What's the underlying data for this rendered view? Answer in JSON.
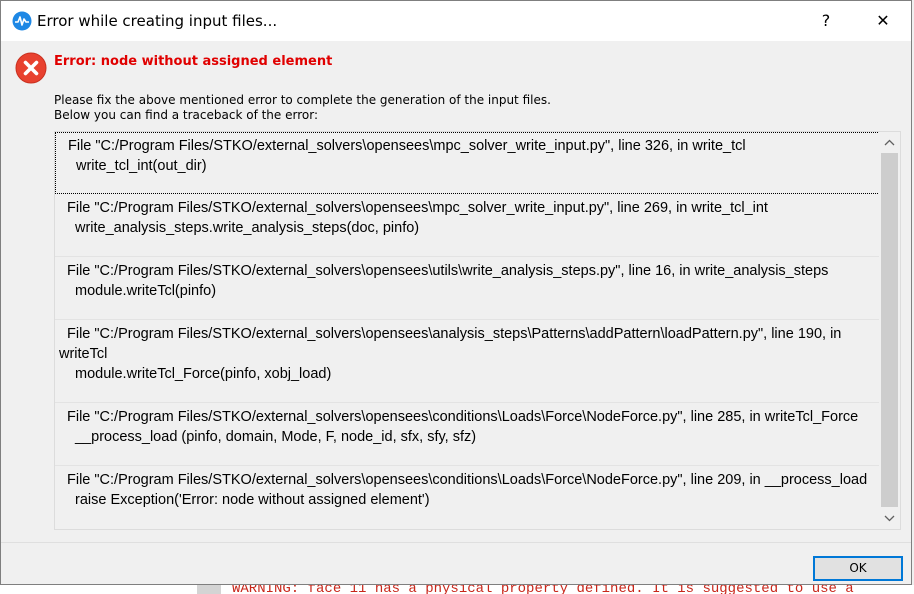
{
  "window": {
    "title": "Error while creating input files...",
    "help_label": "?",
    "close_label": "✕"
  },
  "error": {
    "title": "Error: node without assigned element",
    "message_line1": "Please fix the above mentioned error to complete the generation of the input files.",
    "message_line2": "Below you can find a traceback of the error:"
  },
  "traceback": [
    {
      "file_line": "File \"C:/Program Files/STKO/external_solvers\\opensees\\mpc_solver_write_input.py\", line 326, in write_tcl",
      "code": "write_tcl_int(out_dir)"
    },
    {
      "file_line": "File \"C:/Program Files/STKO/external_solvers\\opensees\\mpc_solver_write_input.py\", line 269, in write_tcl_int",
      "code": "write_analysis_steps.write_analysis_steps(doc, pinfo)"
    },
    {
      "file_line": "File \"C:/Program Files/STKO/external_solvers\\opensees\\utils\\write_analysis_steps.py\", line 16, in write_analysis_steps",
      "code": "module.writeTcl(pinfo)"
    },
    {
      "file_line": "File \"C:/Program Files/STKO/external_solvers\\opensees\\analysis_steps\\Patterns\\addPattern\\loadPattern.py\", line 190, in writeTcl",
      "code": "module.writeTcl_Force(pinfo, xobj_load)"
    },
    {
      "file_line": "File \"C:/Program Files/STKO/external_solvers\\opensees\\conditions\\Loads\\Force\\NodeForce.py\", line 285, in writeTcl_Force",
      "code": "__process_load (pinfo, domain, Mode, F, node_id, sfx, sfy, sfz)"
    },
    {
      "file_line": "File \"C:/Program Files/STKO/external_solvers\\opensees\\conditions\\Loads\\Force\\NodeForce.py\", line 209, in __process_load",
      "code": "raise Exception('Error: node without assigned element')"
    }
  ],
  "buttons": {
    "ok_label": "OK"
  },
  "background": {
    "visible_text": "WARNING: face 11 has a physical property defined. It is suggested to use a"
  },
  "icons": {
    "app": "waveform-icon",
    "error": "error-x-icon",
    "scroll_up": "chevron-up-icon",
    "scroll_down": "chevron-down-icon"
  },
  "colors": {
    "error_red": "#e00000",
    "error_icon_red": "#e8412f",
    "ok_border": "#0078d7",
    "app_icon_blue": "#1e88e5"
  }
}
